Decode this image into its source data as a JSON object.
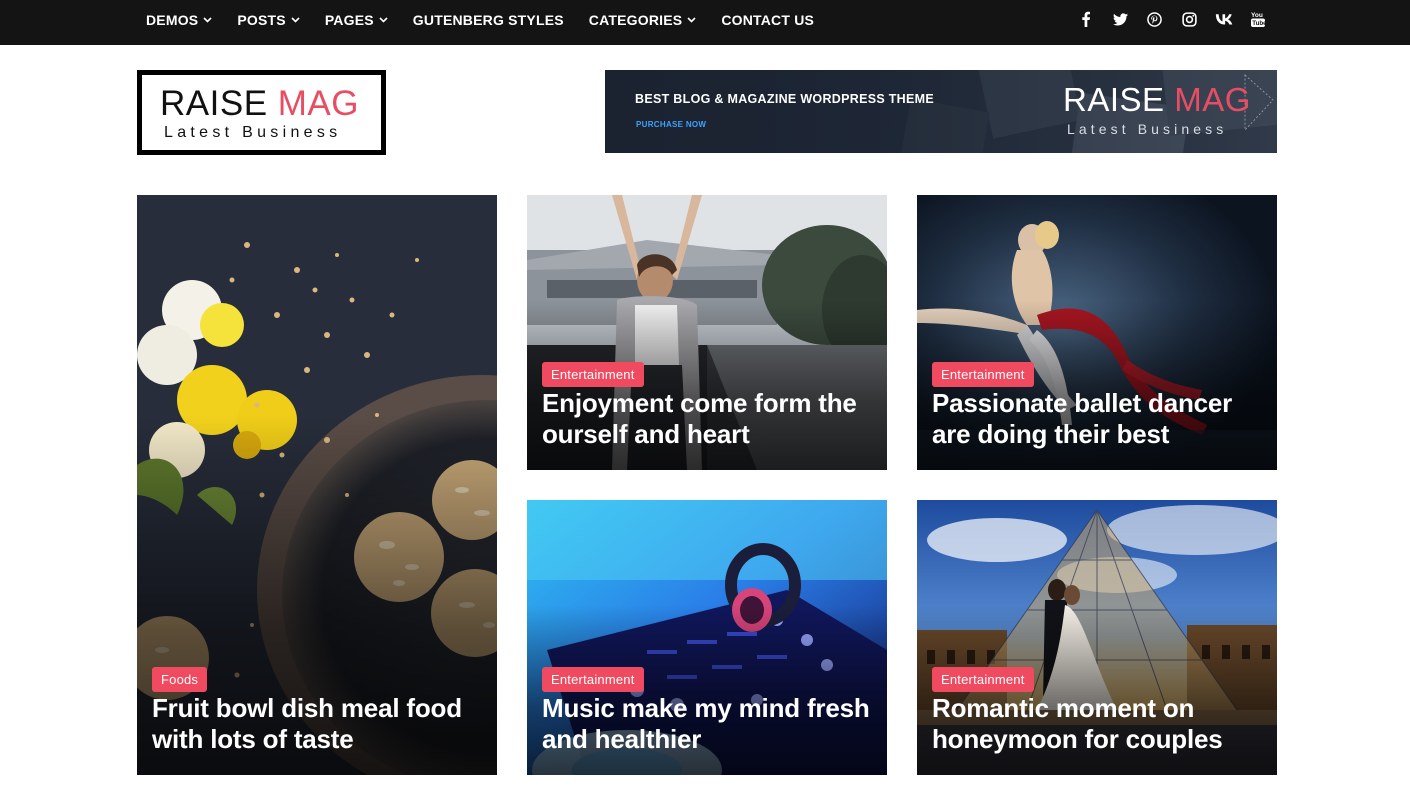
{
  "nav": {
    "items": [
      {
        "label": "DEMOS",
        "has_dropdown": true
      },
      {
        "label": "POSTS",
        "has_dropdown": true
      },
      {
        "label": "PAGES",
        "has_dropdown": true
      },
      {
        "label": "GUTENBERG STYLES",
        "has_dropdown": false
      },
      {
        "label": "CATEGORIES",
        "has_dropdown": true
      },
      {
        "label": "CONTACT US",
        "has_dropdown": false
      }
    ],
    "social_icons": [
      "facebook-icon",
      "twitter-icon",
      "pinterest-icon",
      "instagram-icon",
      "vk-icon",
      "youtube-icon"
    ]
  },
  "logo": {
    "title_part1": "RAISE",
    "title_part2": "MAG",
    "tagline": "Latest Business"
  },
  "banner": {
    "headline": "BEST BLOG & MAGAZINE WORDPRESS THEME",
    "cta": "PURCHASE NOW",
    "logo_part1": "RAISE",
    "logo_part2": "MAG",
    "logo_tagline": "Latest Business"
  },
  "posts": [
    {
      "category": "Foods",
      "title": "Fruit bowl dish meal food with lots of taste"
    },
    {
      "category": "Entertainment",
      "title": "Enjoyment come form the ourself and heart"
    },
    {
      "category": "Entertainment",
      "title": "Passionate ballet dancer are doing their best"
    },
    {
      "category": "Entertainment",
      "title": "Music make my mind fresh and healthier"
    },
    {
      "category": "Entertainment",
      "title": "Romantic moment on honeymoon for couples"
    }
  ],
  "colors": {
    "topbar": "#141414",
    "accent": "#e84e63",
    "badge": "#ef4a5f",
    "banner_link": "#3ea2ff"
  }
}
